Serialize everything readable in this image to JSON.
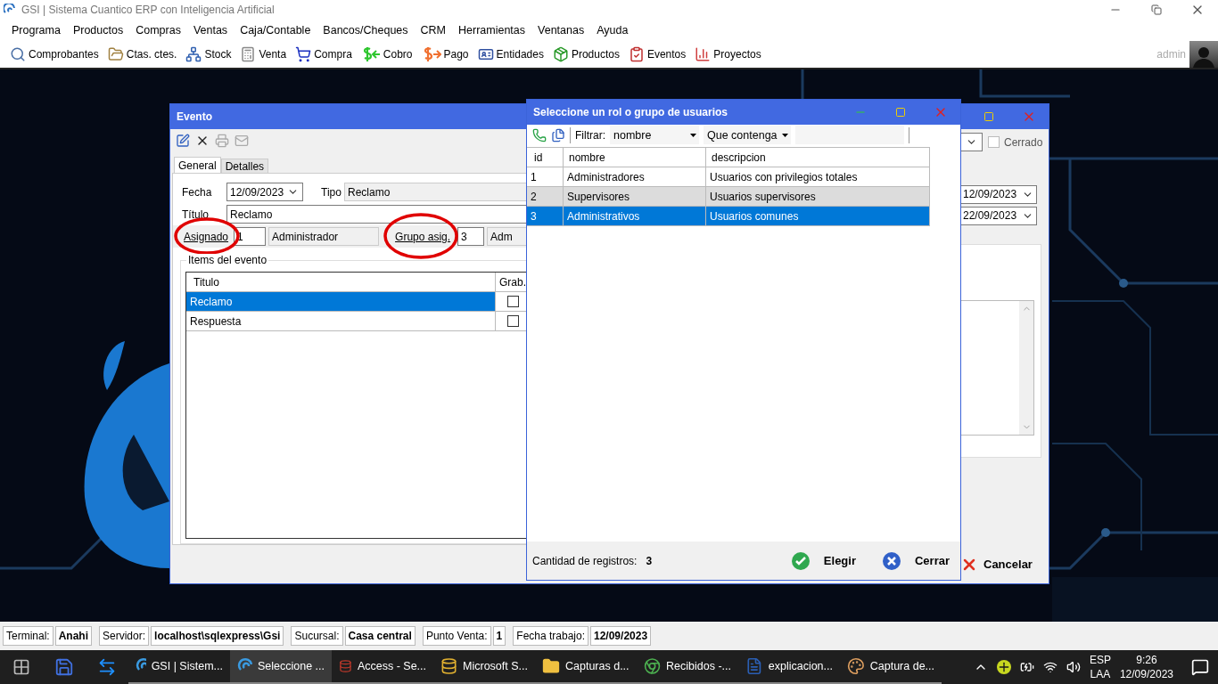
{
  "window": {
    "title": "GSI | Sistema Cuantico ERP con Inteligencia Artificial"
  },
  "menu": [
    "Programa",
    "Productos",
    "Compras",
    "Ventas",
    "Caja/Contable",
    "Bancos/Cheques",
    "CRM",
    "Herramientas",
    "Ventanas",
    "Ayuda"
  ],
  "toolbar": [
    {
      "kind": "search",
      "label": "Comprobantes"
    },
    {
      "kind": "folder",
      "label": "Ctas. ctes."
    },
    {
      "kind": "network",
      "label": "Stock"
    },
    {
      "kind": "register",
      "label": "Venta"
    },
    {
      "kind": "cart",
      "label": "Compra"
    },
    {
      "kind": "cobro",
      "label": "Cobro"
    },
    {
      "kind": "pago",
      "label": "Pago"
    },
    {
      "kind": "card",
      "label": "Entidades"
    },
    {
      "kind": "box",
      "label": "Productos"
    },
    {
      "kind": "notepad",
      "label": "Eventos"
    },
    {
      "kind": "chart",
      "label": "Proyectos"
    }
  ],
  "user": {
    "name": "admin"
  },
  "evento": {
    "title": "Evento",
    "tabs": [
      {
        "label": "General",
        "selected": true
      },
      {
        "label": "Detalles",
        "selected": false
      }
    ],
    "fecha": {
      "label": "Fecha",
      "value": "12/09/2023"
    },
    "tipo": {
      "label": "Tipo",
      "value": "Reclamo"
    },
    "titulo": {
      "label": "Título",
      "value": "Reclamo"
    },
    "asignado": {
      "label": "Asignado",
      "id": "1",
      "name": "Administrador"
    },
    "grupo": {
      "label": "Grupo asig.",
      "id": "3",
      "name": "Adm"
    },
    "items_group": "Items del evento",
    "items_columns": [
      "Titulo",
      "Grab."
    ],
    "items": [
      {
        "titulo": "Reclamo",
        "grab": false,
        "selected": true
      },
      {
        "titulo": "Respuesta",
        "grab": false,
        "selected": false
      }
    ],
    "cerrado": {
      "label": "Cerrado",
      "checked": false
    },
    "dates": [
      "12/09/2023",
      "22/09/2023"
    ],
    "cancel": "Cancelar"
  },
  "dialog": {
    "title": "Seleccione un rol o grupo de usuarios",
    "filter_label": "Filtrar:",
    "filter_field": "nombre",
    "filter_mode": "Que contenga",
    "columns": [
      "id",
      "nombre",
      "descripcion"
    ],
    "rows": [
      {
        "id": "1",
        "nombre": "Administradores",
        "descripcion": "Usuarios con privilegios totales",
        "selected": false
      },
      {
        "id": "2",
        "nombre": "Supervisores",
        "descripcion": "Usuarios supervisores",
        "selected": false
      },
      {
        "id": "3",
        "nombre": "Administrativos",
        "descripcion": "Usuarios comunes",
        "selected": true
      }
    ],
    "count_label": "Cantidad de registros:",
    "count": "3",
    "ok": "Elegir",
    "close": "Cerrar"
  },
  "status_bar": [
    {
      "label": "Terminal:",
      "value": "Anahi"
    },
    {
      "label": "Servidor:",
      "value": "localhost\\sqlexpress\\Gsi"
    },
    {
      "label": "Sucursal:",
      "value": "Casa central"
    },
    {
      "label": "Punto Venta:",
      "value": "1"
    },
    {
      "label": "Fecha trabajo:",
      "value": "12/09/2023"
    }
  ],
  "taskbar": {
    "apps": [
      {
        "kind": "gsi",
        "label": "GSI | Sistem...",
        "active": false
      },
      {
        "kind": "gsi",
        "label": "Seleccione ...",
        "active": true
      },
      {
        "kind": "access",
        "label": "Access - Se...",
        "active": false
      },
      {
        "kind": "sql",
        "label": "Microsoft S...",
        "active": false
      },
      {
        "kind": "folder",
        "label": "Capturas d...",
        "active": false
      },
      {
        "kind": "chrome",
        "label": "Recibidos -...",
        "active": false
      },
      {
        "kind": "word",
        "label": "explicacion...",
        "active": false
      },
      {
        "kind": "paint",
        "label": "Captura de...",
        "active": false
      }
    ],
    "lang": "ESP",
    "region": "LAA",
    "time": "9:26",
    "date": "12/09/2023"
  }
}
